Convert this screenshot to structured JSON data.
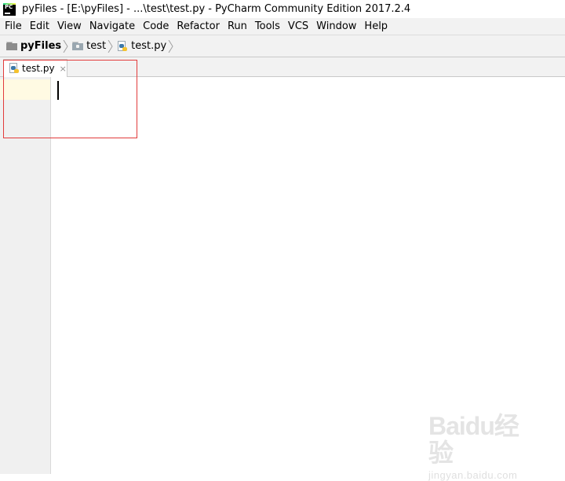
{
  "window": {
    "app_icon_text": "PC",
    "title": "pyFiles - [E:\\pyFiles] - ...\\test\\test.py - PyCharm Community Edition 2017.2.4"
  },
  "menu": {
    "items": [
      {
        "label": "File"
      },
      {
        "label": "Edit"
      },
      {
        "label": "View"
      },
      {
        "label": "Navigate"
      },
      {
        "label": "Code"
      },
      {
        "label": "Refactor"
      },
      {
        "label": "Run"
      },
      {
        "label": "Tools"
      },
      {
        "label": "VCS"
      },
      {
        "label": "Window"
      },
      {
        "label": "Help"
      }
    ]
  },
  "breadcrumb": {
    "items": [
      {
        "label": "pyFiles",
        "icon": "folder-icon"
      },
      {
        "label": "test",
        "icon": "package-folder-icon"
      },
      {
        "label": "test.py",
        "icon": "python-file-icon"
      }
    ]
  },
  "editor_tabs": [
    {
      "label": "test.py",
      "icon": "python-file-icon",
      "close": "×"
    }
  ],
  "watermark": {
    "logo": "Baidu经验",
    "url": "jingyan.baidu.com"
  },
  "colors": {
    "highlight_box": "#e23b3b",
    "current_line": "#fffae3"
  }
}
